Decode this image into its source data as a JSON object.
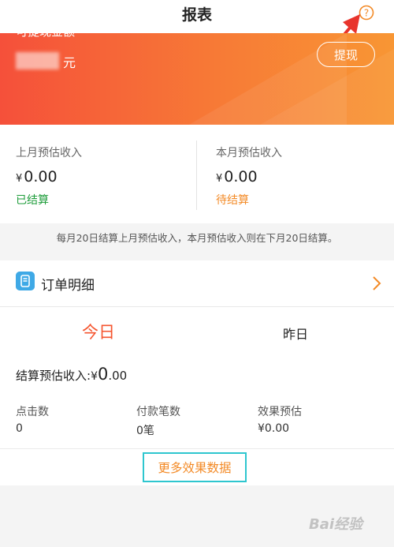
{
  "header": {
    "title": "报表"
  },
  "banner": {
    "label": "可提现金额",
    "unit": "元",
    "withdraw_label": "提现"
  },
  "income": {
    "last_month": {
      "label": "上月预估收入",
      "currency": "¥",
      "amount": "0.00",
      "status": "已结算"
    },
    "this_month": {
      "label": "本月预估收入",
      "currency": "¥",
      "amount": "0.00",
      "status": "待结算"
    }
  },
  "notice": "每月20日结算上月预估收入，本月预估收入则在下月20日结算。",
  "orders": {
    "title": "订单明细",
    "tabs": {
      "today": "今日",
      "yesterday": "昨日"
    },
    "settle_label": "结算预估收入:",
    "settle_currency": "¥",
    "settle_int": "0",
    "settle_dec": ".00",
    "stats": [
      {
        "label": "点击数",
        "value": "0"
      },
      {
        "label": "付款笔数",
        "value": "0笔"
      },
      {
        "label": "效果预估",
        "value": "¥0.00"
      }
    ],
    "more_label": "更多效果数据"
  },
  "watermark": "Bai经验",
  "colors": {
    "accent_orange": "#f38a26",
    "today_red": "#f5552f",
    "settled_green": "#1e9c3a",
    "highlight_teal": "#2ec6cf"
  }
}
